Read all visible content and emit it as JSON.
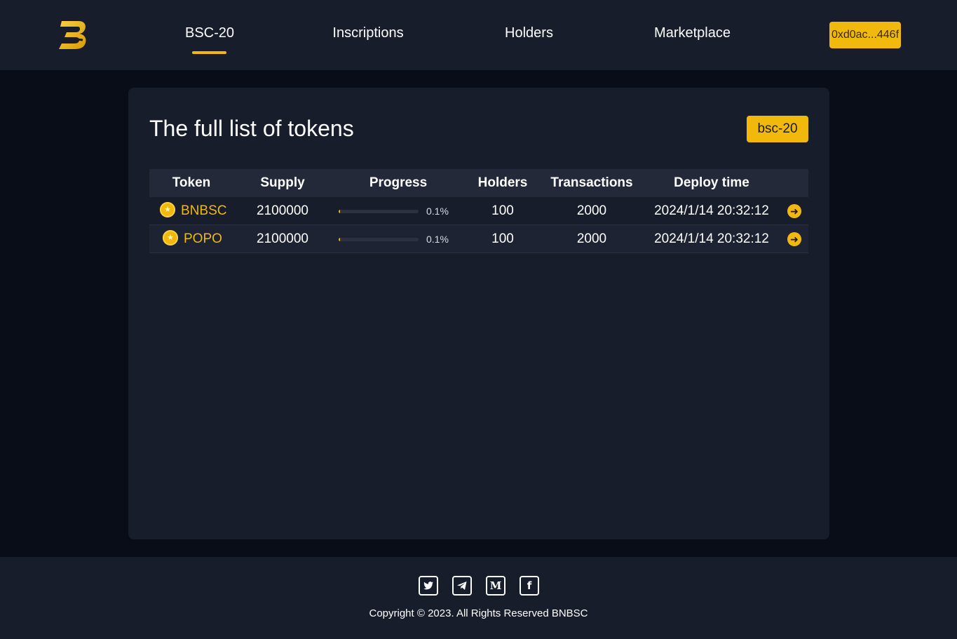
{
  "header": {
    "logo_alt": "BNBSC logo",
    "nav": [
      {
        "label": "BSC-20",
        "active": true
      },
      {
        "label": "Inscriptions",
        "active": false
      },
      {
        "label": "Holders",
        "active": false
      },
      {
        "label": "Marketplace",
        "active": false
      }
    ],
    "wallet_label": "0xd0ac...446f"
  },
  "main": {
    "title": "The full list of tokens",
    "tag_label": "bsc-20",
    "table": {
      "columns": [
        "Token",
        "Supply",
        "Progress",
        "Holders",
        "Transactions",
        "Deploy time"
      ],
      "rows": [
        {
          "token": "BNBSC",
          "supply": "2100000",
          "progress": 0.1,
          "progress_label": "0.1%",
          "holders": "100",
          "transactions": "2000",
          "deploy_time": "2024/1/14 20:32:12"
        },
        {
          "token": "POPO",
          "supply": "2100000",
          "progress": 0.1,
          "progress_label": "0.1%",
          "holders": "100",
          "transactions": "2000",
          "deploy_time": "2024/1/14 20:32:12"
        }
      ]
    }
  },
  "footer": {
    "social_icons": [
      "twitter-icon",
      "telegram-icon",
      "medium-icon",
      "facebook-icon"
    ],
    "copyright": "Copyright © 2023. All Rights Reserved BNBSC"
  },
  "colors": {
    "accent": "#f0b90b",
    "background": "#080d18",
    "panel": "#181d2b"
  }
}
